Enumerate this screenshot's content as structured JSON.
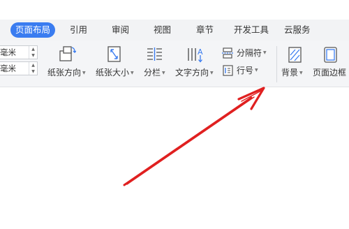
{
  "tabs": [
    {
      "label": "页面布局",
      "active": true
    },
    {
      "label": "引用"
    },
    {
      "label": "审阅"
    },
    {
      "label": "视图"
    },
    {
      "label": "章节"
    },
    {
      "label": "开发工具"
    },
    {
      "label": "云服务"
    }
  ],
  "toolbar": {
    "margin_1_value": "毫米",
    "margin_2_value": "毫米",
    "orientation_label": "纸张方向",
    "size_label": "纸张大小",
    "columns_label": "分栏",
    "text_direction_label": "文字方向",
    "separator_label": "分隔符",
    "line_number_label": "行号",
    "background_label": "背景",
    "page_border_label": "页面边框"
  },
  "colors": {
    "accent": "#3a7cf0",
    "arrow": "#e02020",
    "toolbar_bg": "#f4f5f7"
  }
}
